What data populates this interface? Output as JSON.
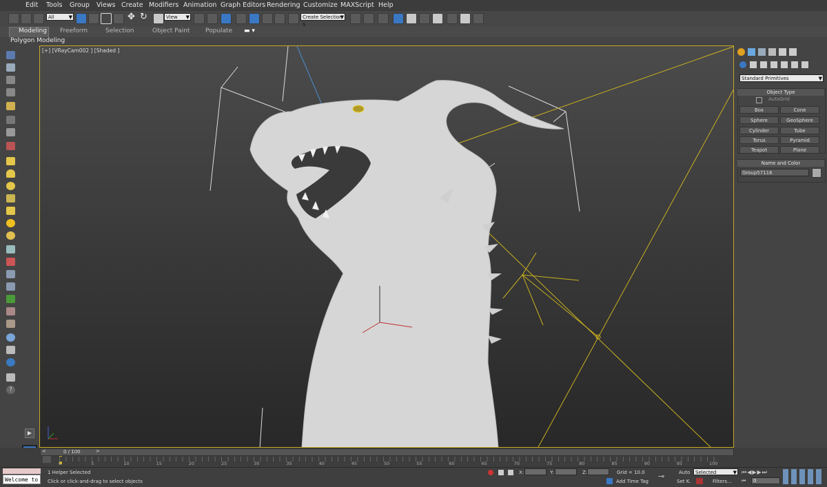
{
  "menu": [
    "Edit",
    "Tools",
    "Group",
    "Views",
    "Create",
    "Modifiers",
    "Animation",
    "Graph Editors",
    "Rendering",
    "Customize",
    "MAXScript",
    "Help"
  ],
  "toolbar": {
    "filter": "All",
    "ref_coord": "View",
    "selection_set": "Create Selection S"
  },
  "ribbon": {
    "tabs": [
      "Modeling",
      "Freeform",
      "Selection",
      "Object Paint",
      "Populate"
    ],
    "subtab": "Polygon Modeling"
  },
  "viewport": {
    "label": "[+] [VRayCam002 ] [Shaded ]"
  },
  "command_panel": {
    "category": "Standard Primitives",
    "object_type_title": "Object Type",
    "autogrid": "AutoGrid",
    "buttons": [
      "Box",
      "Cone",
      "Sphere",
      "GeoSphere",
      "Cylinder",
      "Tube",
      "Torus",
      "Pyramid",
      "Teapot",
      "Plane"
    ],
    "name_color_title": "Name and Color",
    "object_name": "Group57116"
  },
  "timeline": {
    "frame": "0 / 100",
    "ticks": [
      "0",
      "5",
      "10",
      "15",
      "20",
      "25",
      "30",
      "35",
      "40",
      "45",
      "50",
      "55",
      "60",
      "65",
      "70",
      "75",
      "80",
      "85",
      "90",
      "95",
      "100"
    ]
  },
  "status": {
    "maxscript": "Welcome to",
    "selected_count": "1 Helper Selected",
    "prompt": "Click or click-and-drag to select objects",
    "x_label": "X:",
    "y_label": "Y:",
    "z_label": "Z:",
    "grid": "Grid = 10.0",
    "add_time_tag": "Add Time Tag",
    "auto": "Auto",
    "key_mode": "Selected",
    "set_key": "Set K.",
    "filters": "Filters...",
    "current_frame": "0"
  },
  "colors": {
    "viewport_border": "#c7a624",
    "accent": "#3a78c4",
    "model": "#d9d9d9"
  }
}
